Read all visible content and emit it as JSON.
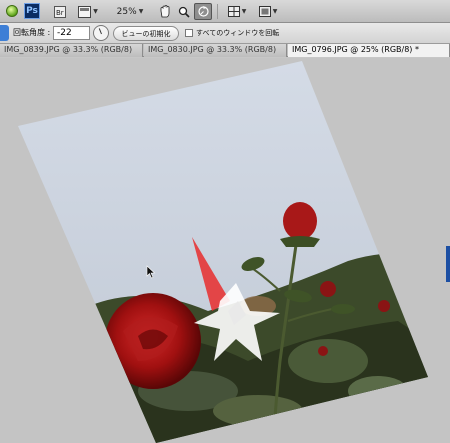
{
  "app_bar": {
    "logo_text": "Ps",
    "zoom_label": "25%",
    "icons": [
      "traffic-light-icon",
      "bridge-icon",
      "view-extras-icon",
      "hand-tool-icon",
      "zoom-tool-icon",
      "rotate-view-tool-icon",
      "arrange-documents-icon",
      "screen-mode-icon"
    ]
  },
  "options": {
    "angle_label": "回転角度 :",
    "angle_value": "-22",
    "reset_label": "ビューの初期化",
    "all_windows_label": "すべてのウィンドウを回転",
    "all_windows_checked": false
  },
  "tabs": [
    {
      "label": "IMG_0839.JPG @ 33.3% (RGB/8)",
      "active": false
    },
    {
      "label": "IMG_0830.JPG @ 33.3% (RGB/8)",
      "active": false
    },
    {
      "label": "IMG_0796.JPG @ 25% (RGB/8) *",
      "active": true
    }
  ],
  "canvas": {
    "rotation_degrees": -22,
    "accent_color": "#e82d2d",
    "background_color": "#c4c4c4"
  }
}
